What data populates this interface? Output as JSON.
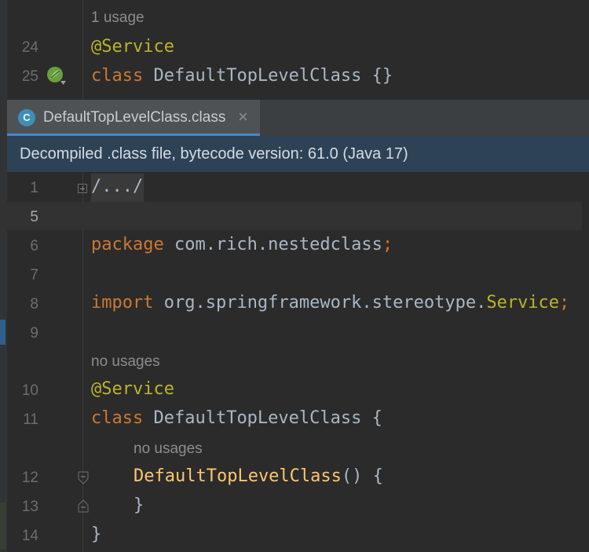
{
  "top_editor": {
    "usage_hint": "1 usage",
    "lines": [
      {
        "number": "24",
        "annotation": "@Service"
      },
      {
        "number": "25",
        "keyword": "class",
        "name": "DefaultTopLevelClass",
        "tail": " {}"
      }
    ],
    "gutter_icon": "bean-implementation-icon"
  },
  "tab": {
    "icon": "class-file-icon",
    "icon_letter": "C",
    "label": "DefaultTopLevelClass.class",
    "close": "×"
  },
  "banner": {
    "text": "Decompiled .class file, bytecode version: 61.0 (Java 17)"
  },
  "editor": {
    "line_numbers": {
      "l1": "1",
      "l5": "5",
      "l6": "6",
      "l7": "7",
      "l8": "8",
      "l9": "9",
      "l10": "10",
      "l11": "11",
      "l12": "12",
      "l13": "13",
      "l14": "14"
    },
    "folded": "/.../",
    "package_kw": "package",
    "package_name": " com.rich.nestedclass",
    "semicolon": ";",
    "import_kw": "import",
    "import_path": " org.springframework.stereotype.",
    "import_class": "Service",
    "hint_class": "no usages",
    "annotation": "@Service",
    "class_kw": "class",
    "class_name": " DefaultTopLevelClass {",
    "hint_ctor": "no usages",
    "ctor_name": "DefaultTopLevelClass",
    "ctor_tail": "() {",
    "ctor_close": "}",
    "class_close": "}"
  }
}
